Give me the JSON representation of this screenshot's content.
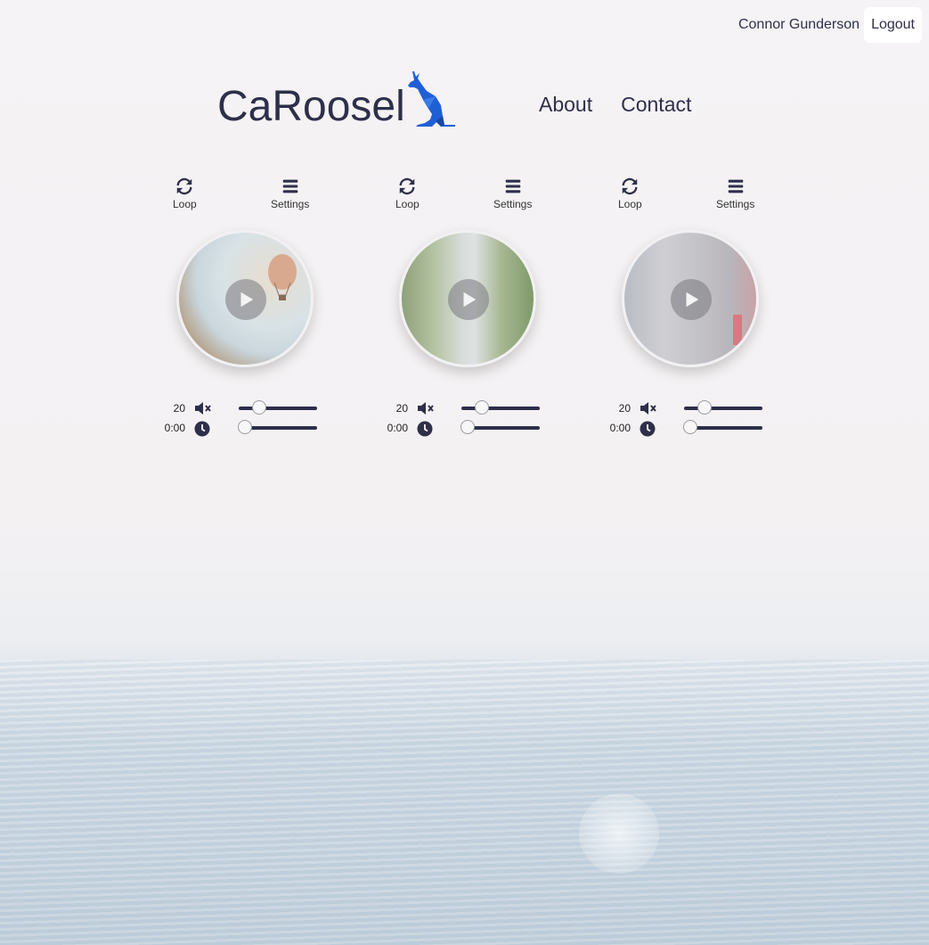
{
  "header": {
    "username": "Connor Gunderson",
    "logout_label": "Logout",
    "brand": "CaRoosel",
    "nav": [
      "About",
      "Contact"
    ]
  },
  "players": [
    {
      "loop_label": "Loop",
      "settings_label": "Settings",
      "volume": "20",
      "time": "0:00",
      "volume_level": 0.2,
      "time_progress": 0,
      "scene": "hot-air-balloon"
    },
    {
      "loop_label": "Loop",
      "settings_label": "Settings",
      "volume": "20",
      "time": "0:00",
      "volume_level": 0.2,
      "time_progress": 0,
      "scene": "stream-in-forest"
    },
    {
      "loop_label": "Loop",
      "settings_label": "Settings",
      "volume": "20",
      "time": "0:00",
      "volume_level": 0.2,
      "time_progress": 0,
      "scene": "city-street"
    }
  ],
  "icons": {
    "loop": "loop-icon",
    "settings": "hamburger-icon",
    "mute": "volume-mute-icon",
    "clock": "clock-icon",
    "play": "play-icon",
    "logo": "kangaroo-icon"
  },
  "colors": {
    "text": "#2e2f4a",
    "logo": "#1f5fd6"
  }
}
